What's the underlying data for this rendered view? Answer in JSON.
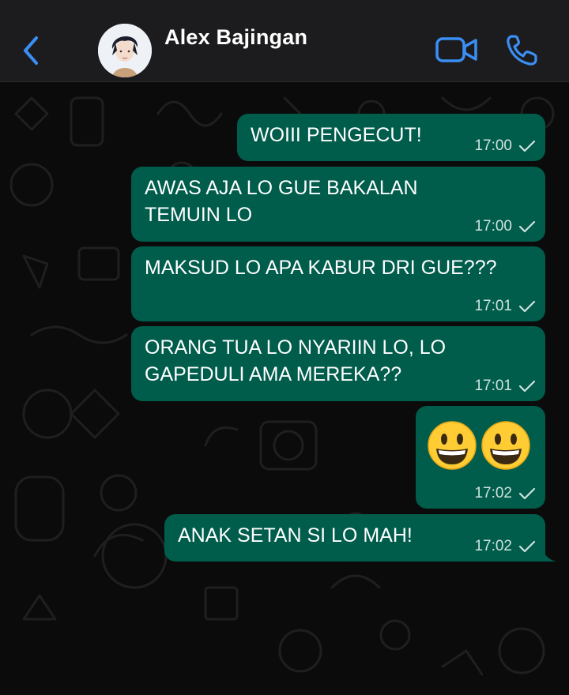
{
  "header": {
    "contact_name": "Alex Bajingan",
    "icons": [
      "back-chevron-icon",
      "avatar",
      "video-call-icon",
      "voice-call-icon"
    ],
    "accent_color": "#3a8ff5"
  },
  "messages": [
    {
      "text": "WOIII PENGECUT!",
      "time": "17:00",
      "status": "sent"
    },
    {
      "text": "AWAS AJA LO GUE BAKALAN\nTEMUIN LO",
      "time": "17:00",
      "status": "sent"
    },
    {
      "text": "MAKSUD LO APA KABUR DRI GUE???",
      "time": "17:01",
      "status": "sent"
    },
    {
      "text": "ORANG TUA LO NYARIIN LO, LO\nGAPEDULI AMA MEREKA??",
      "time": "17:01",
      "status": "sent"
    },
    {
      "text": "",
      "emojis": [
        "grinning-face-emoji",
        "grinning-face-emoji"
      ],
      "time": "17:02",
      "status": "sent"
    },
    {
      "text": "ANAK SETAN SI LO MAH!",
      "time": "17:02",
      "status": "sent"
    }
  ],
  "colors": {
    "header_bg": "#1c1c1e",
    "chat_bg": "#0b0b0b",
    "outgoing_bubble": "#005c4b"
  }
}
